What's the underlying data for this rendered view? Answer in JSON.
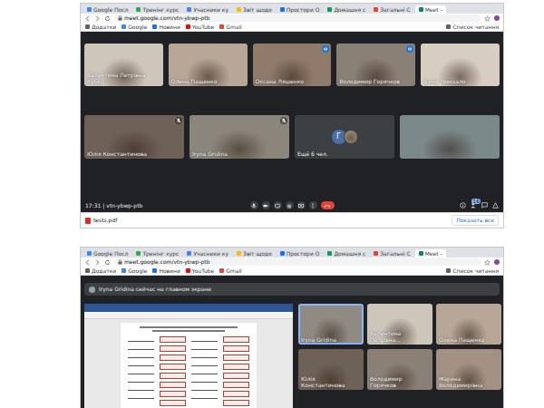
{
  "grid_view": {
    "browser": {
      "tabs": [
        {
          "label": "Google Посл",
          "selected": false
        },
        {
          "label": "Тренінг курс",
          "selected": false
        },
        {
          "label": "Учасники ку",
          "selected": false
        },
        {
          "label": "Звіт щодо",
          "selected": false
        },
        {
          "label": "Простори О",
          "selected": false
        },
        {
          "label": "Домашня с",
          "selected": false
        },
        {
          "label": "Загальні С",
          "selected": false
        },
        {
          "label": "Meet –",
          "selected": true
        }
      ],
      "address": "meet.google.com/vtn-ybwp-ptb",
      "bookmarks": [
        "Додатки",
        "Google",
        "Новини",
        "YouTube",
        "Gmail"
      ],
      "reading_list": "Список читання"
    },
    "tiles_row1": [
      {
        "name": "Валентина Петрівна Кубко",
        "speaking": false
      },
      {
        "name": "Олена Пащенко",
        "speaking": false
      },
      {
        "name": "Оксана Ляшенко",
        "speaking": true
      },
      {
        "name": "Володимир Горячков",
        "speaking": true
      },
      {
        "name": "Ірина Чмихало",
        "speaking": false
      }
    ],
    "tiles_row2": [
      {
        "name": "Юлія Константинова",
        "muted": true
      },
      {
        "name": "Iryna Gridina",
        "muted": true
      },
      {
        "name": "",
        "muted": false
      }
    ],
    "more_tile": {
      "avatar": "Г",
      "label": "Ещё 6 чел."
    },
    "control_bar": {
      "time": "17:31",
      "separator": "|",
      "code": "vtn-ybwp-ptb",
      "participants_count": "16"
    },
    "downloads": {
      "file": "tests.pdf",
      "show_all": "Показать все"
    }
  },
  "presentation_view": {
    "browser": {
      "tabs": [
        {
          "label": "Google Посл",
          "selected": false
        },
        {
          "label": "Тренінг курс",
          "selected": false
        },
        {
          "label": "Учасники ку",
          "selected": false
        },
        {
          "label": "Звіт щодо",
          "selected": false
        },
        {
          "label": "Простори О",
          "selected": false
        },
        {
          "label": "Домашня с",
          "selected": false
        },
        {
          "label": "Загальні С",
          "selected": false
        },
        {
          "label": "Meet –",
          "selected": true
        }
      ],
      "address": "meet.google.com/vtn-ybwp-ptb",
      "bookmarks": [
        "Додатки",
        "Google",
        "Новини",
        "YouTube",
        "Gmail"
      ],
      "reading_list": "Список читання"
    },
    "banner": "Iryna Gridina сейчас на главном экране",
    "tiles": [
      {
        "name": "Iryna Gridina",
        "speaking": true
      },
      {
        "name": "Валентина Петрівна...",
        "speaking": false
      },
      {
        "name": "Олена Пащенко",
        "speaking": false
      },
      {
        "name": "Юлія Константинова",
        "speaking": false
      },
      {
        "name": "Володимир Горячков",
        "speaking": false
      },
      {
        "name": "Марина Володимирівна",
        "speaking": false
      }
    ]
  }
}
